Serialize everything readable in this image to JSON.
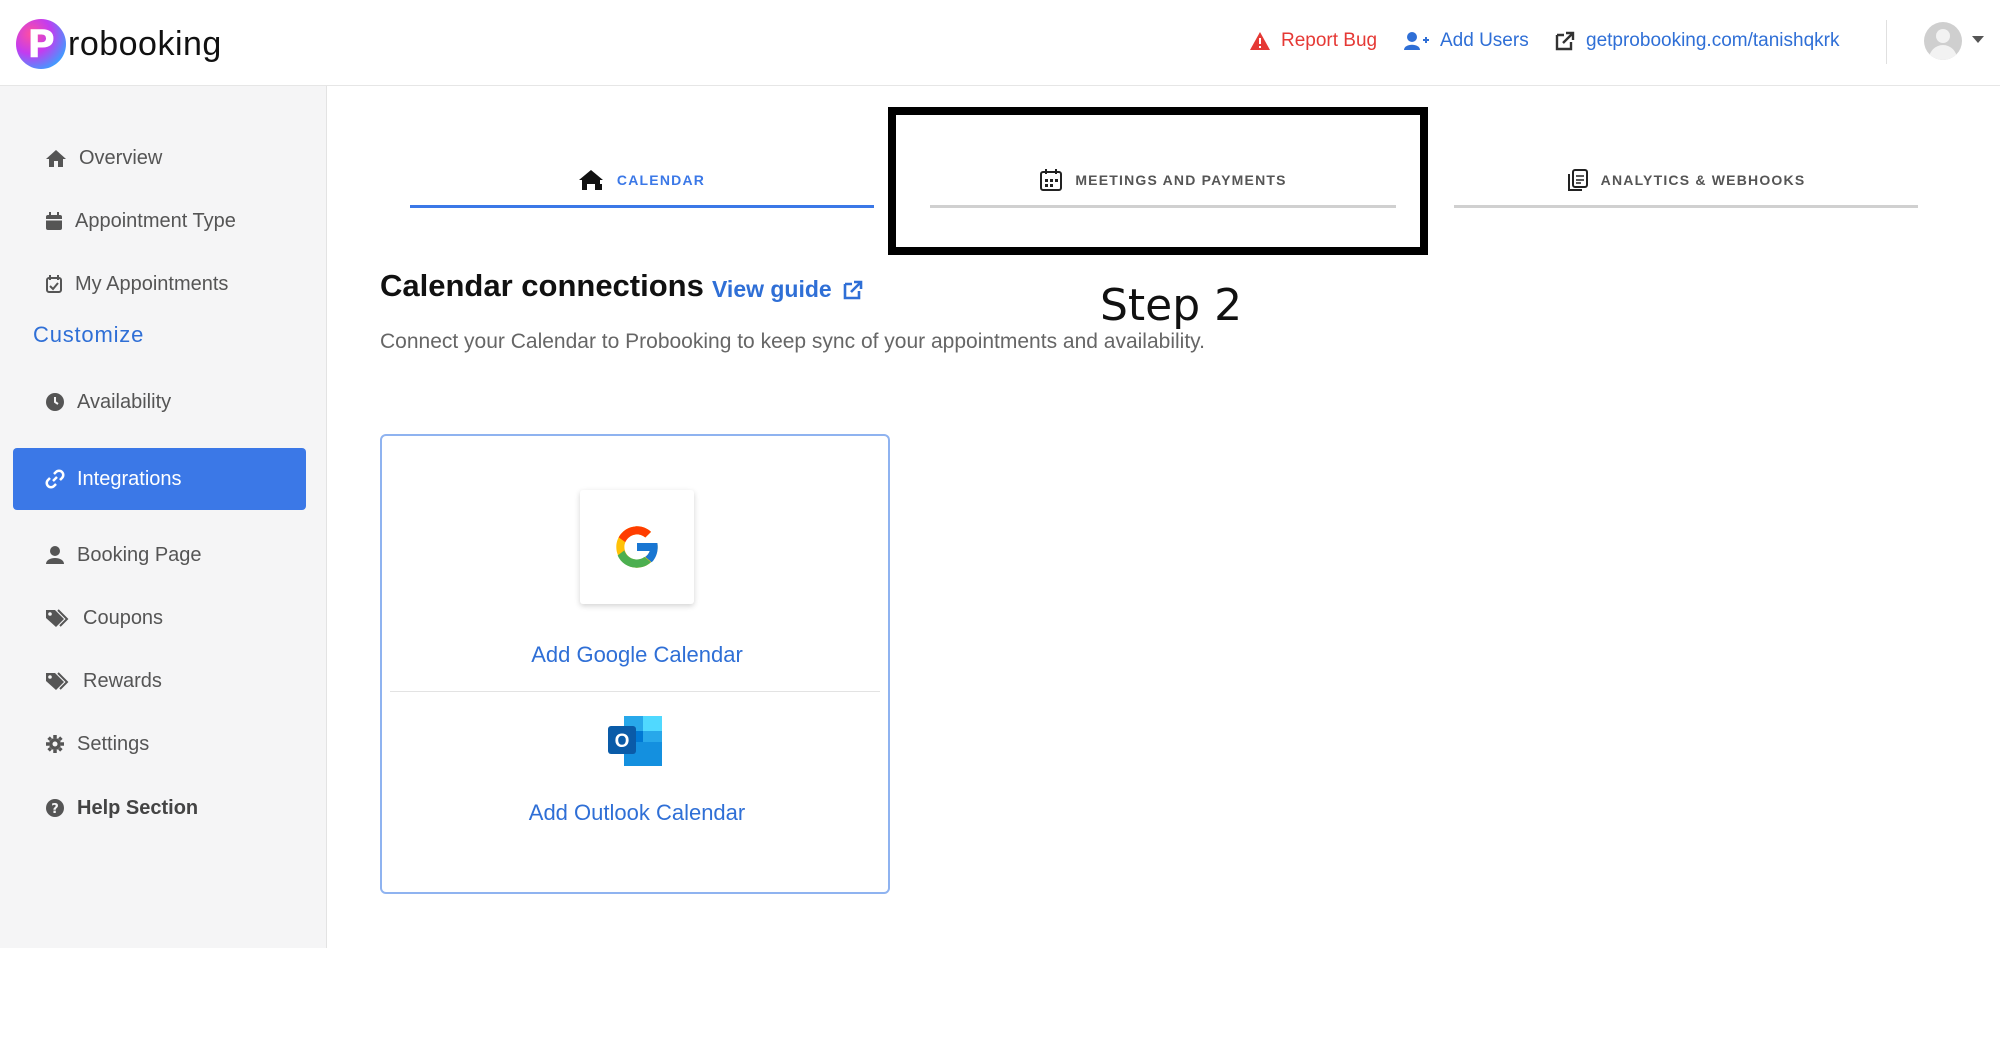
{
  "header": {
    "logo_letter": "P",
    "logo_text": "robooking",
    "report_bug": "Report Bug",
    "add_users": "Add Users",
    "public_link": "getprobooking.com/tanishqkrk"
  },
  "sidebar": {
    "items": [
      {
        "label": "Overview",
        "icon": "home-icon"
      },
      {
        "label": "Appointment Type",
        "icon": "calendar-icon"
      },
      {
        "label": "My Appointments",
        "icon": "calendar-check-icon"
      }
    ],
    "customize_heading": "Customize",
    "customize_items": [
      {
        "label": "Availability",
        "icon": "clock-icon"
      },
      {
        "label": "Integrations",
        "icon": "link-icon",
        "active": true
      },
      {
        "label": "Booking Page",
        "icon": "user-icon"
      },
      {
        "label": "Coupons",
        "icon": "tags-icon"
      },
      {
        "label": "Rewards",
        "icon": "tags-icon"
      },
      {
        "label": "Settings",
        "icon": "gear-icon"
      },
      {
        "label": "Help Section",
        "icon": "question-circle-icon"
      }
    ]
  },
  "tabs": [
    {
      "label": "CALENDAR",
      "icon": "calendar-home-icon",
      "active": true
    },
    {
      "label": "MEETINGS AND PAYMENTS",
      "icon": "meetings-calendar-icon"
    },
    {
      "label": "ANALYTICS & WEBHOOKS",
      "icon": "analytics-document-icon"
    }
  ],
  "annotation": {
    "step_label": "Step 2"
  },
  "content": {
    "title": "Calendar connections",
    "view_guide": "View guide",
    "subtitle": "Connect your Calendar to Probooking to keep sync of your appointments and availability.",
    "google": "Add Google Calendar",
    "outlook": "Add Outlook Calendar",
    "outlook_letter": "O"
  },
  "colors": {
    "accent": "#3b78e7",
    "link": "#2f6fd6",
    "danger": "#e53935",
    "sidebar_bg": "#f5f5f6"
  }
}
